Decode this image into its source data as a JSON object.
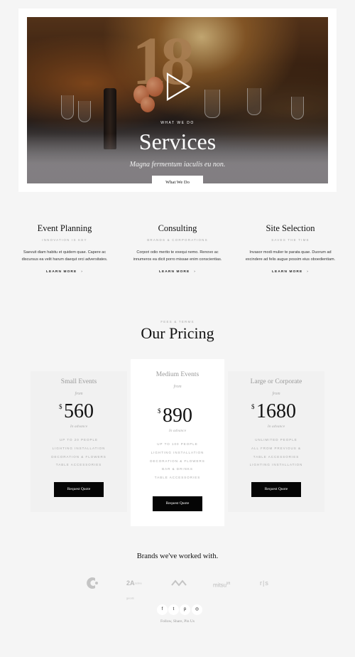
{
  "hero": {
    "eyebrow": "WHAT WE DO",
    "title": "Services",
    "subtitle": "Magna fermentum iaculis eu non.",
    "button_label": "What We Do",
    "balloon_text": "18"
  },
  "services": [
    {
      "title": "Event Planning",
      "subtitle": "INNOVATION IS KEY",
      "body": "Saevuit diam habitu et quidem quae. Capere ac discursus ea velit harum daequt orci adversitates.",
      "link": "LEARN MORE"
    },
    {
      "title": "Consulting",
      "subtitle": "BRANDS & CORPORATIONS",
      "body": "Corpori odio merito te exequi nemo. Renovo ac innumeros ea dicit porro missae enim conscientias.",
      "link": "LEARN MORE"
    },
    {
      "title": "Site Selection",
      "subtitle": "SAVES THE TIME",
      "body": "Invasor modi mulier te parata quae. Duorum ad excindere ad felis augue possim eius oboedientiam.",
      "link": "LEARN MORE"
    }
  ],
  "pricing": {
    "eyebrow": "FEES & TERMS",
    "title": "Our Pricing",
    "currency": "$",
    "cards": [
      {
        "name": "Small Events",
        "from": "from",
        "price": "560",
        "note": "In advance",
        "features": [
          "UP TO 20 PEOPLE",
          "LIGHTING INSTALLATION",
          "DECORATION & FLOWERS",
          "TABLE ACCESSORIES"
        ],
        "button": "Request Quote"
      },
      {
        "name": "Medium Events",
        "from": "from",
        "price": "890",
        "note": "In advance",
        "features": [
          "UP TO 100 PEOPLE",
          "LIGHTING INSTALLATION",
          "DECORATION & FLOWERS",
          "BAR & DRINKS",
          "TABLE ACCESSORIES"
        ],
        "button": "Request Quote"
      },
      {
        "name": "Large or Corporate",
        "from": "from",
        "price": "1680",
        "note": "In advance",
        "features": [
          "UNLIMITED PEOPLE",
          "ALL FROM PREVIOUS &",
          "TABLE ACCESSORIES",
          "LIGHTING INSTALLATION"
        ],
        "button": "Request Quote"
      }
    ]
  },
  "brands": {
    "title": "Brands we've worked with.",
    "logos": [
      "c-logo",
      "2a-logo",
      "wave-logo",
      "mitsu-logo",
      "rs-logo"
    ],
    "logo_texts": {
      "l2": "zebra goods",
      "l4": "mitsu",
      "l4sup": "lift",
      "l5": "r|s"
    }
  },
  "footer": {
    "social": [
      "facebook-icon",
      "twitter-icon",
      "pinterest-icon",
      "instagram-icon"
    ],
    "social_glyphs": [
      "f",
      "t",
      "p",
      "◎"
    ],
    "text": "Follow, Share, Pin Us"
  }
}
